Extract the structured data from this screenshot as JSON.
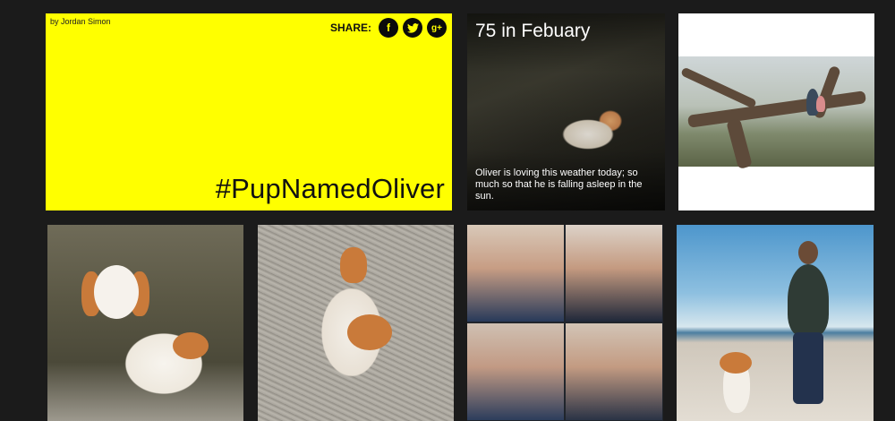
{
  "hero": {
    "byline": "by Jordan Simon",
    "share_label": "SHARE:",
    "share_icons": [
      "facebook-icon",
      "twitter-icon",
      "google-plus-icon"
    ],
    "share_glyphs": [
      "f",
      "t",
      "g+"
    ],
    "hashtag": "#PupNamedOliver",
    "background": "#ffff00"
  },
  "post": {
    "title": "75 in Febuary",
    "caption": "Oliver is loving this weather today; so much so that he is falling asleep in the sun."
  },
  "photos": [
    {
      "subject": "tree-photo"
    },
    {
      "subject": "dog-on-couch-photo"
    },
    {
      "subject": "dog-on-sand-photo"
    },
    {
      "subject": "couple-collage-photo"
    },
    {
      "subject": "woman-dog-beach-photo"
    }
  ]
}
